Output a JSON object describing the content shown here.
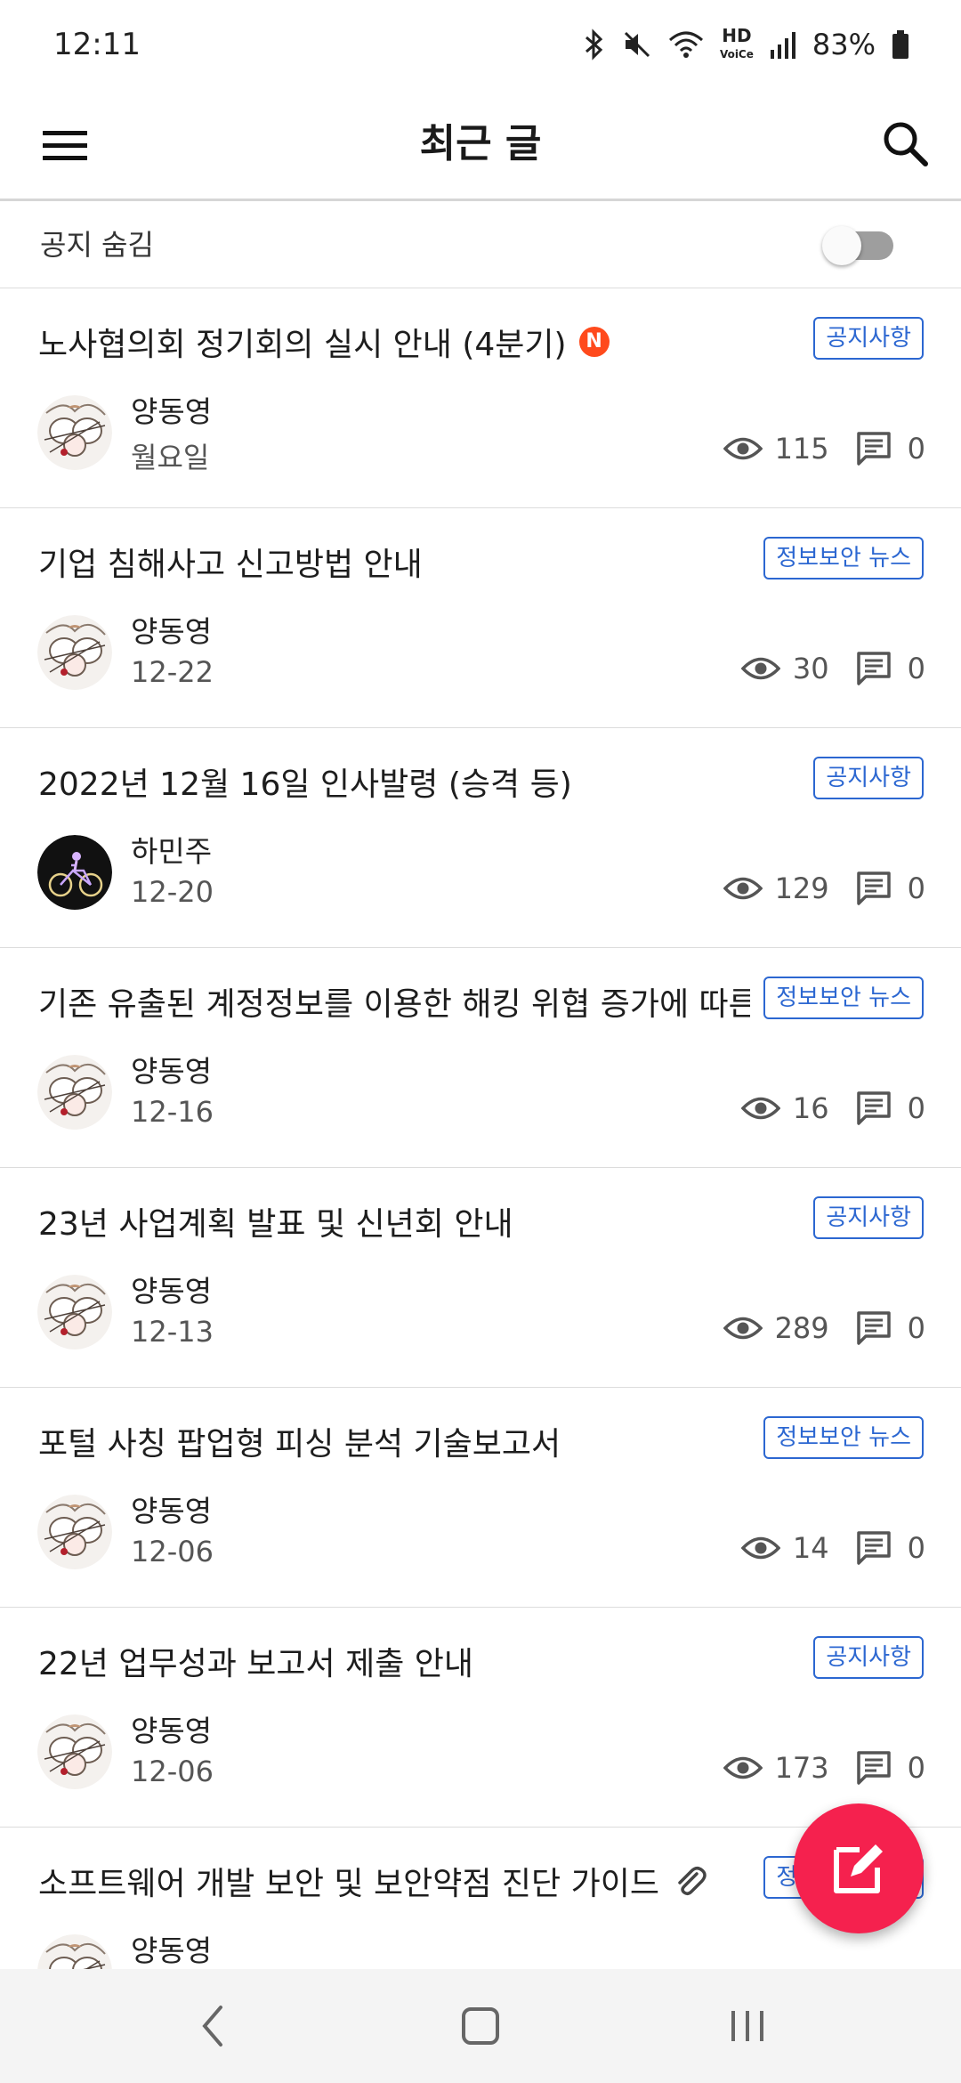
{
  "status_bar": {
    "time": "12:11",
    "battery": "83%"
  },
  "app_bar": {
    "title": "최근 글"
  },
  "notice_toggle": {
    "label": "공지 숨김",
    "on": false
  },
  "posts": [
    {
      "title": "노사협의회 정기회의 실시 안내 (4분기)",
      "is_new": true,
      "new_badge": "N",
      "category": "공지사항",
      "author": "양동영",
      "date": "월요일",
      "views": "115",
      "comments": "0",
      "avatar": "cotton"
    },
    {
      "title": "기업 침해사고 신고방법 안내",
      "category": "정보보안 뉴스",
      "author": "양동영",
      "date": "12-22",
      "views": "30",
      "comments": "0",
      "avatar": "cotton"
    },
    {
      "title": "2022년 12월 16일 인사발령 (승격 등)",
      "category": "공지사항",
      "author": "하민주",
      "date": "12-20",
      "views": "129",
      "comments": "0",
      "avatar": "bicycle"
    },
    {
      "title": "기존 유출된 계정정보를 이용한 해킹 위협 증가에 따른 ...",
      "category": "정보보안 뉴스",
      "author": "양동영",
      "date": "12-16",
      "views": "16",
      "comments": "0",
      "avatar": "cotton"
    },
    {
      "title": "23년 사업계획 발표 및 신년회 안내",
      "category": "공지사항",
      "author": "양동영",
      "date": "12-13",
      "views": "289",
      "comments": "0",
      "avatar": "cotton"
    },
    {
      "title": "포털 사칭 팝업형 피싱 분석 기술보고서",
      "category": "정보보안 뉴스",
      "author": "양동영",
      "date": "12-06",
      "views": "14",
      "comments": "0",
      "avatar": "cotton"
    },
    {
      "title": "22년 업무성과 보고서 제출 안내",
      "category": "공지사항",
      "author": "양동영",
      "date": "12-06",
      "views": "173",
      "comments": "0",
      "avatar": "cotton"
    },
    {
      "title": "소프트웨어 개발 보안 및 보안약점 진단 가이드",
      "has_attachment": true,
      "category": "정보보안 뉴스",
      "author": "양동영",
      "date": "",
      "views": "",
      "comments": "",
      "avatar": "cotton"
    }
  ],
  "icons": {
    "menu": "menu-icon",
    "search": "search-icon",
    "views": "eye-icon",
    "comments": "comment-icon",
    "fab": "compose-icon",
    "attachment": "paperclip-icon"
  },
  "colors": {
    "accent": "#2c67d1",
    "fab": "#f5214e",
    "new_badge": "#ff4a1c"
  }
}
